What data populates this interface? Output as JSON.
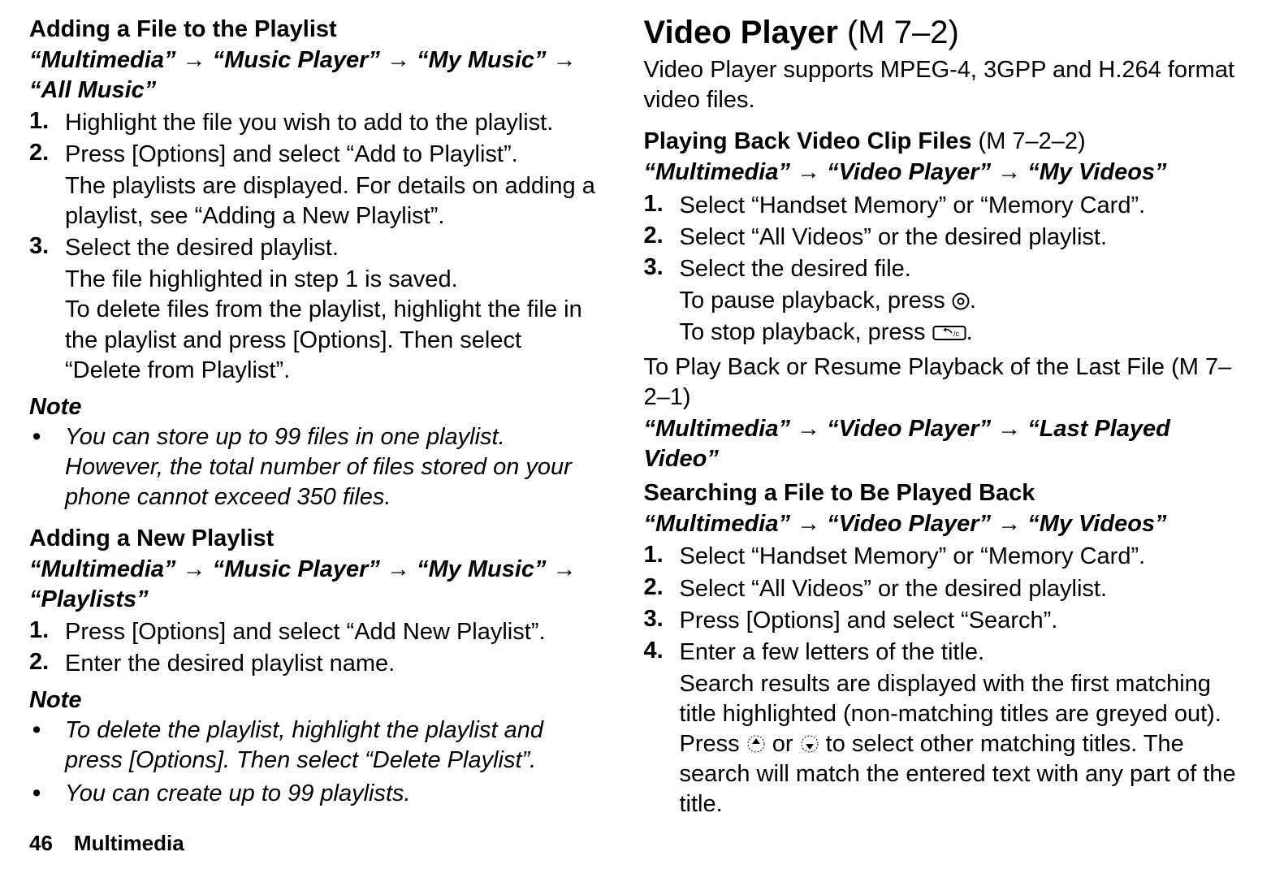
{
  "left": {
    "addFile": {
      "heading": "Adding a File to the Playlist",
      "path": "“Multimedia” → “Music Player” → “My Music” → “All Music”",
      "steps": [
        {
          "n": "1.",
          "text": "Highlight the file you wish to add to the playlist."
        },
        {
          "n": "2.",
          "text": "Press [Options] and select “Add to Playlist”.",
          "sub": "The playlists are displayed. For details on adding a playlist, see “Adding a New Playlist”."
        },
        {
          "n": "3.",
          "text": "Select the desired playlist.",
          "sub": "The file highlighted in step 1 is saved.\nTo delete files from the playlist, highlight the file in the playlist and press [Options]. Then select “Delete from Playlist”."
        }
      ],
      "noteLabel": "Note",
      "notes": [
        "You can store up to 99 files in one playlist. However, the total number of files stored on your phone cannot exceed 350 files."
      ]
    },
    "addNew": {
      "heading": "Adding a New Playlist",
      "path": "“Multimedia” → “Music Player” → “My Music” → “Playlists”",
      "steps": [
        {
          "n": "1.",
          "text": "Press [Options] and select “Add New Playlist”."
        },
        {
          "n": "2.",
          "text": "Enter the desired playlist name."
        }
      ],
      "noteLabel": "Note",
      "notes": [
        "To delete the playlist, highlight the playlist and press [Options]. Then select “Delete Playlist”.",
        "You can create up to 99 playlists."
      ]
    }
  },
  "right": {
    "videoPlayer": {
      "title_prefix": "Video Player ",
      "title_code": "(M 7–2)",
      "intro": "Video Player supports MPEG-4, 3GPP and H.264 format video files."
    },
    "playing": {
      "heading_prefix": "Playing Back Video Clip Files ",
      "heading_code": "(M 7–2–2)",
      "path": "“Multimedia” → “Video Player” → “My Videos”",
      "steps": [
        {
          "n": "1.",
          "text": "Select “Handset Memory” or “Memory Card”."
        },
        {
          "n": "2.",
          "text": "Select “All Videos” or the desired playlist."
        },
        {
          "n": "3.",
          "text": "Select the desired file.",
          "sub_pause_before": "To pause playback, press ",
          "sub_pause_after": ".",
          "sub_stop_before": "To stop playback, press ",
          "sub_stop_after": "."
        }
      ]
    },
    "resume": {
      "line_prefix": "To Play Back or Resume Playback of the Last File ",
      "line_code": "(M 7–2–1)",
      "path": "“Multimedia” → “Video Player” → “Last Played Video”"
    },
    "search": {
      "heading": "Searching a File to Be Played Back",
      "path": "“Multimedia” → “Video Player” → “My Videos”",
      "steps": [
        {
          "n": "1.",
          "text": "Select “Handset Memory” or “Memory Card”."
        },
        {
          "n": "2.",
          "text": "Select “All Videos” or the desired playlist."
        },
        {
          "n": "3.",
          "text": "Press [Options] and select “Search”."
        },
        {
          "n": "4.",
          "text": "Enter a few letters of the title.",
          "sub_before_up": "Search results are displayed with the first matching title highlighted (non-matching titles are greyed out). Press ",
          "sub_between": " or ",
          "sub_after_down": " to select other matching titles. The search will match the entered text with any part of the title."
        }
      ]
    }
  },
  "footer": "46 Multimedia"
}
